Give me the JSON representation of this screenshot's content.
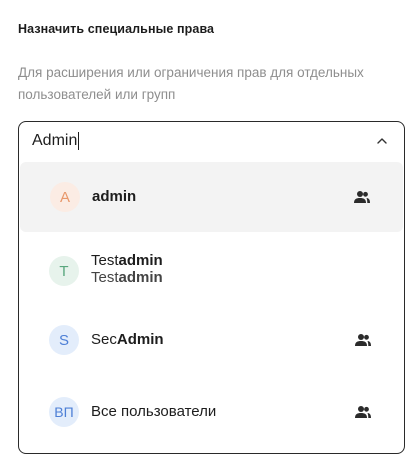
{
  "header": {
    "title": "Назначить специальные права",
    "description": "Для расширения или ограничения прав для отдельных пользователей или групп"
  },
  "combo": {
    "value": "Admin",
    "chevron_icon": "chevron-up-icon"
  },
  "options": [
    {
      "avatar": "A",
      "avatar_bg": "#fbece4",
      "avatar_fg": "#e8976a",
      "prefix": "",
      "match": "admin",
      "suffix": "",
      "sub_prefix": "",
      "sub_match": "",
      "group": true,
      "highlighted": true
    },
    {
      "avatar": "T",
      "avatar_bg": "#e7f3ec",
      "avatar_fg": "#5aa77e",
      "prefix": "Test",
      "match": "admin",
      "suffix": "",
      "sub_prefix": "Test",
      "sub_match": "admin",
      "group": false,
      "highlighted": false
    },
    {
      "avatar": "S",
      "avatar_bg": "#e3edfb",
      "avatar_fg": "#4d7fd6",
      "prefix": "Sec",
      "match": "Admin",
      "suffix": "",
      "sub_prefix": "",
      "sub_match": "",
      "group": true,
      "highlighted": false
    },
    {
      "avatar": "ВП",
      "avatar_bg": "#e3edfb",
      "avatar_fg": "#4d7fd6",
      "prefix": "Все пользователи",
      "match": "",
      "suffix": "",
      "sub_prefix": "",
      "sub_match": "",
      "group": true,
      "highlighted": false
    }
  ]
}
